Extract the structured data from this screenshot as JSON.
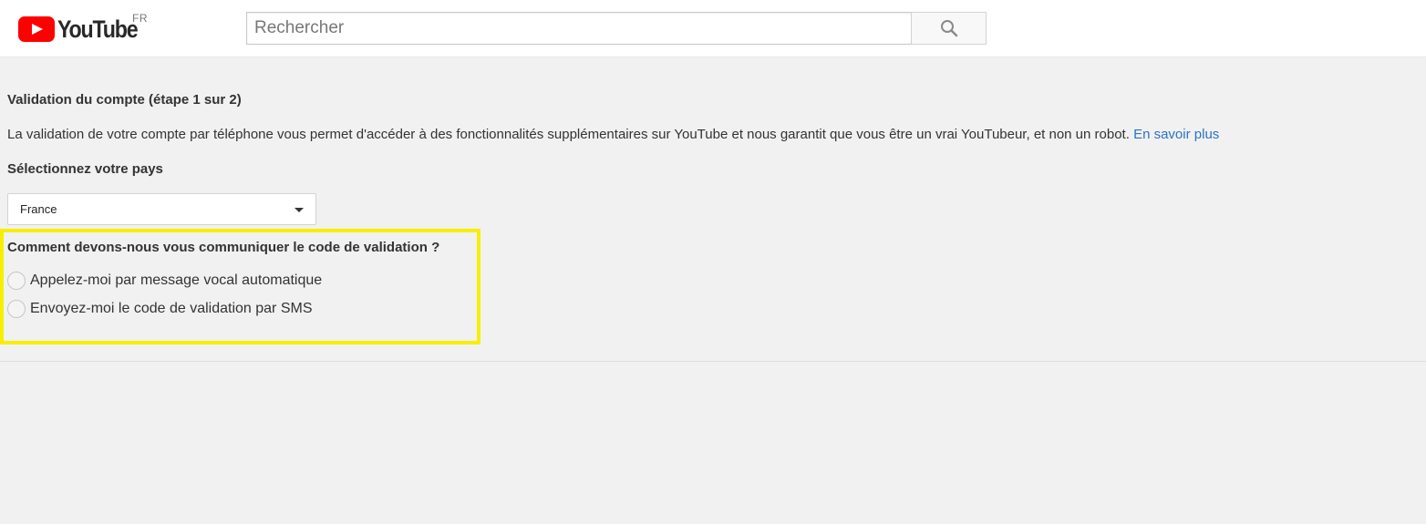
{
  "header": {
    "logo_text": "YouTube",
    "logo_country": "FR",
    "search_placeholder": "Rechercher"
  },
  "icons": {
    "logo": "youtube-play-icon",
    "search": "search-icon",
    "dropdown": "chevron-down-icon"
  },
  "colors": {
    "brand_red": "#ff0000",
    "link_blue": "#2b73c6",
    "highlight_yellow": "#f7ee00"
  },
  "verification": {
    "title": "Validation du compte (étape 1 sur 2)",
    "description": "La validation de votre compte par téléphone vous permet d'accéder à des fonctionnalités supplémentaires sur YouTube et nous garantit que vous être un vrai YouTubeur, et non un robot.",
    "learn_more_link": "En savoir plus",
    "country_label": "Sélectionnez votre pays",
    "country_selected": "France",
    "method_question": "Comment devons-nous vous communiquer le code de validation ?",
    "method_options": [
      {
        "label": "Appelez-moi par message vocal automatique",
        "selected": false
      },
      {
        "label": "Envoyez-moi le code de validation par SMS",
        "selected": false
      }
    ]
  }
}
